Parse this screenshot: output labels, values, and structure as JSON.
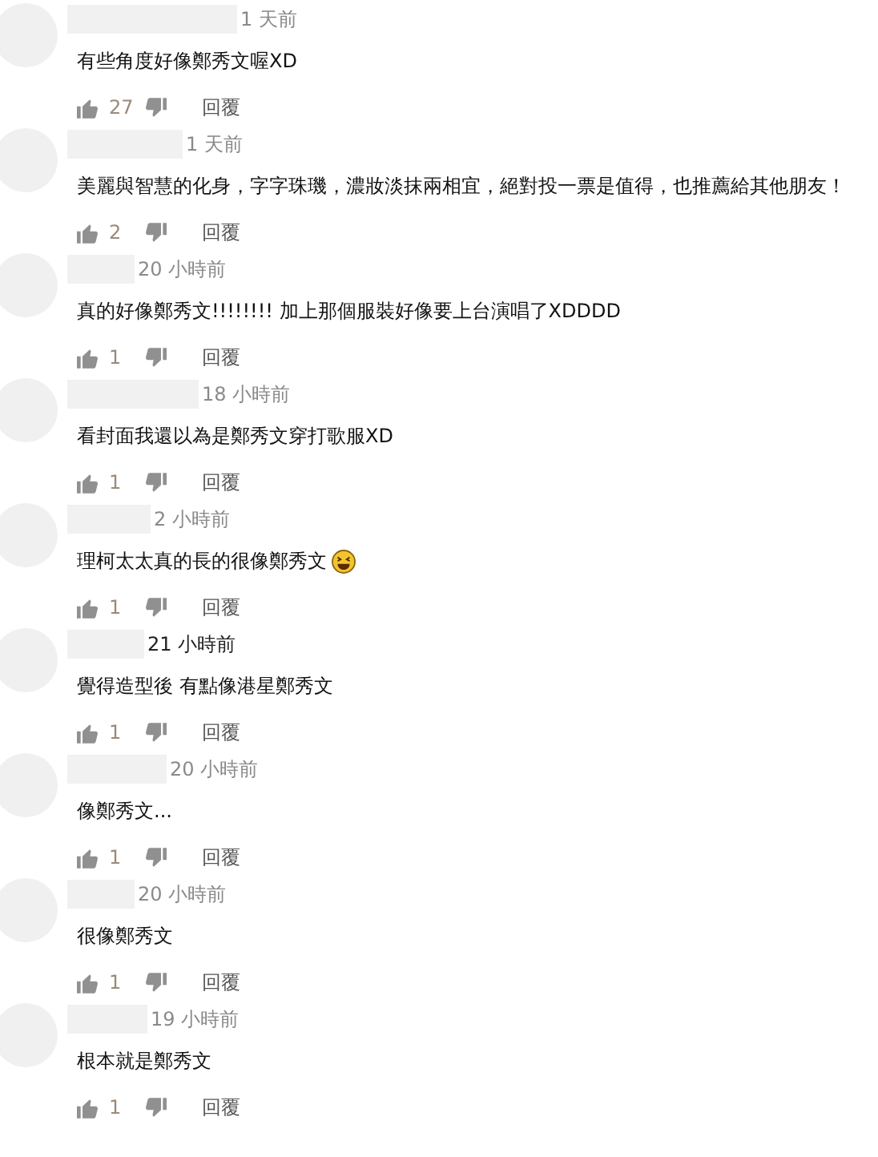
{
  "comments": [
    {
      "time": "1 天前",
      "time_highlighted": false,
      "text": "有些角度好像鄭秀文喔XD",
      "emoji": false,
      "likes": "27",
      "reply": "回覆"
    },
    {
      "time": "1 天前",
      "time_highlighted": false,
      "text": "美麗與智慧的化身，字字珠璣，濃妝淡抹兩相宜，絕對投一票是值得，也推薦給其他朋友！",
      "emoji": false,
      "likes": "2",
      "reply": "回覆"
    },
    {
      "time": "20 小時前",
      "time_highlighted": false,
      "text": "真的好像鄭秀文!!!!!!!! 加上那個服裝好像要上台演唱了XDDDD",
      "emoji": false,
      "likes": "1",
      "reply": "回覆"
    },
    {
      "time": "18 小時前",
      "time_highlighted": false,
      "text": "看封面我還以為是鄭秀文穿打歌服XD",
      "emoji": false,
      "likes": "1",
      "reply": "回覆"
    },
    {
      "time": "2 小時前",
      "time_highlighted": false,
      "text": "理柯太太真的長的很像鄭秀文",
      "emoji": true,
      "likes": "1",
      "reply": "回覆"
    },
    {
      "time": "21 小時前",
      "time_highlighted": true,
      "text": "覺得造型後 有點像港星鄭秀文",
      "emoji": false,
      "likes": "1",
      "reply": "回覆"
    },
    {
      "time": "20 小時前",
      "time_highlighted": false,
      "text": "像鄭秀文...",
      "emoji": false,
      "likes": "1",
      "reply": "回覆"
    },
    {
      "time": "20 小時前",
      "time_highlighted": false,
      "text": "很像鄭秀文",
      "emoji": false,
      "likes": "1",
      "reply": "回覆"
    },
    {
      "time": "19 小時前",
      "time_highlighted": false,
      "text": "根本就是鄭秀文",
      "emoji": false,
      "likes": "1",
      "reply": "回覆"
    }
  ]
}
